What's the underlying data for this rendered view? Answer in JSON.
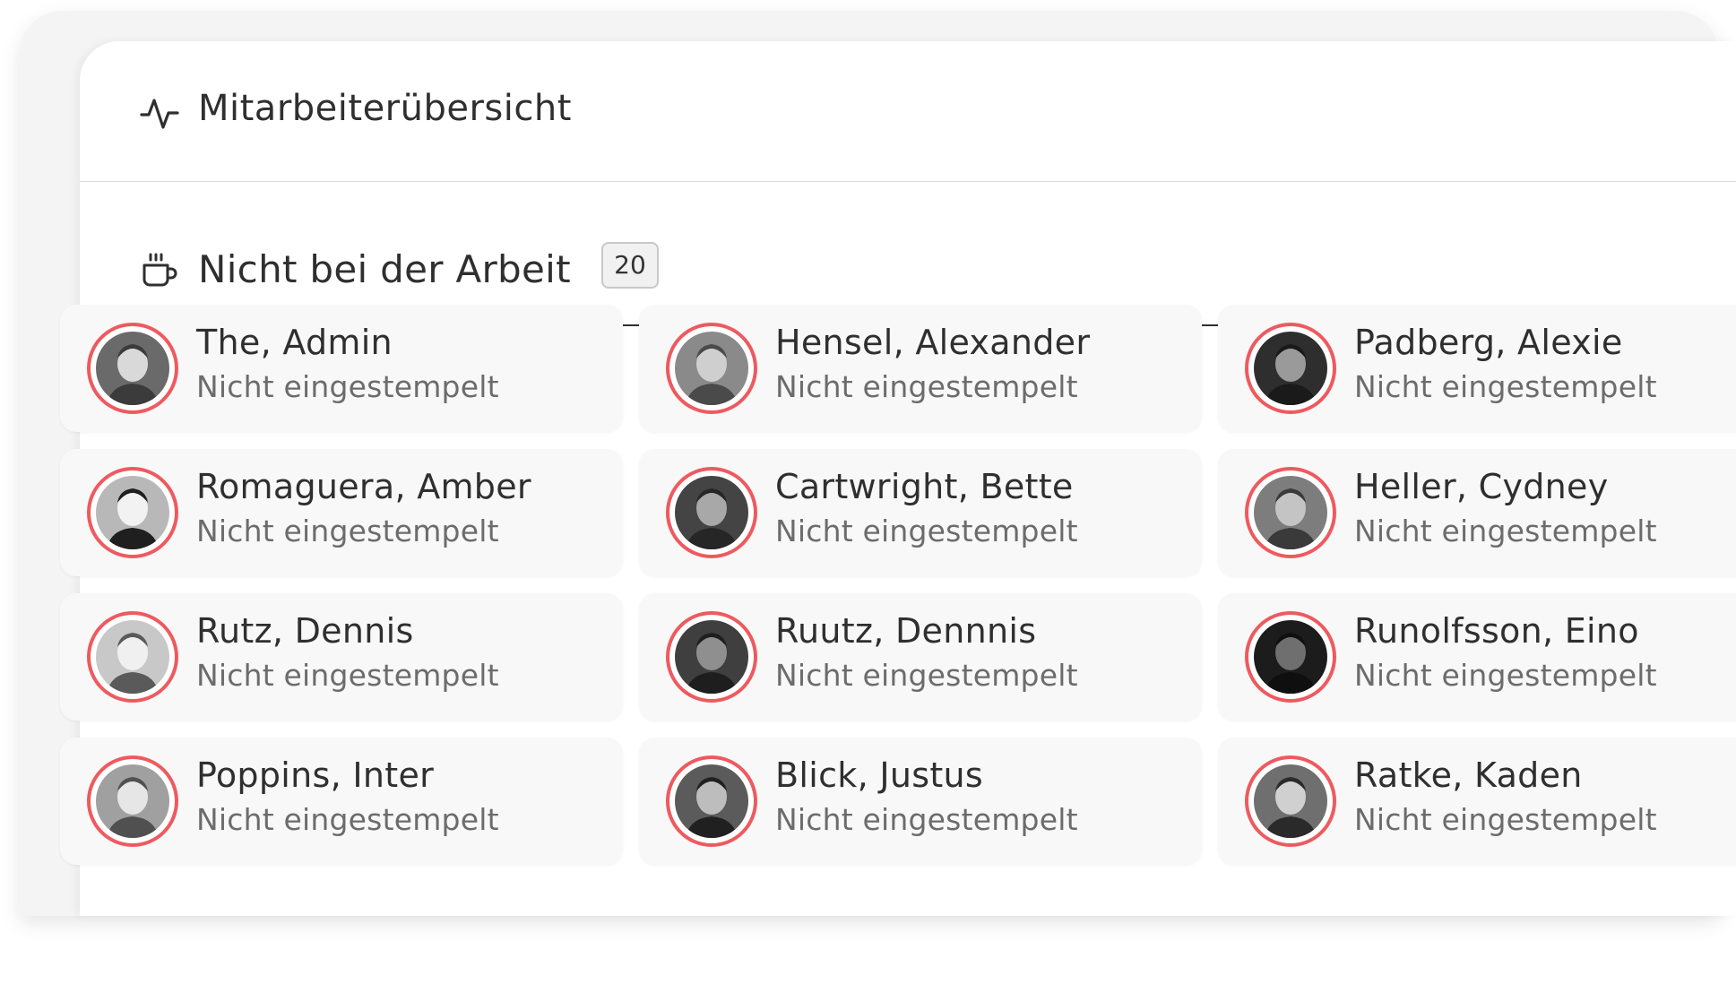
{
  "header": {
    "title": "Mitarbeiterübersicht",
    "icon": "activity-icon"
  },
  "section": {
    "title": "Nicht bei der Arbeit",
    "count": "20",
    "icon": "coffee-cup-icon"
  },
  "colors": {
    "accent_ring": "#ee5a5f",
    "text_primary": "#2f2f2f",
    "text_secondary": "#6c6c6c",
    "card_bg": "#f8f8f8"
  },
  "employees": [
    {
      "name": "The, Admin",
      "status": "Nicht eingestempelt"
    },
    {
      "name": "Hensel, Alexander",
      "status": "Nicht eingestempelt"
    },
    {
      "name": "Padberg, Alexie",
      "status": "Nicht eingestempelt"
    },
    {
      "name": "Romaguera, Amber",
      "status": "Nicht eingestempelt"
    },
    {
      "name": "Cartwright, Bette",
      "status": "Nicht eingestempelt"
    },
    {
      "name": "Heller, Cydney",
      "status": "Nicht eingestempelt"
    },
    {
      "name": "Rutz, Dennis",
      "status": "Nicht eingestempelt"
    },
    {
      "name": "Ruutz, Dennnis",
      "status": "Nicht eingestempelt"
    },
    {
      "name": "Runolfsson, Eino",
      "status": "Nicht eingestempelt"
    },
    {
      "name": "Poppins, Inter",
      "status": "Nicht eingestempelt"
    },
    {
      "name": "Blick, Justus",
      "status": "Nicht eingestempelt"
    },
    {
      "name": "Ratke, Kaden",
      "status": "Nicht eingestempelt"
    }
  ]
}
